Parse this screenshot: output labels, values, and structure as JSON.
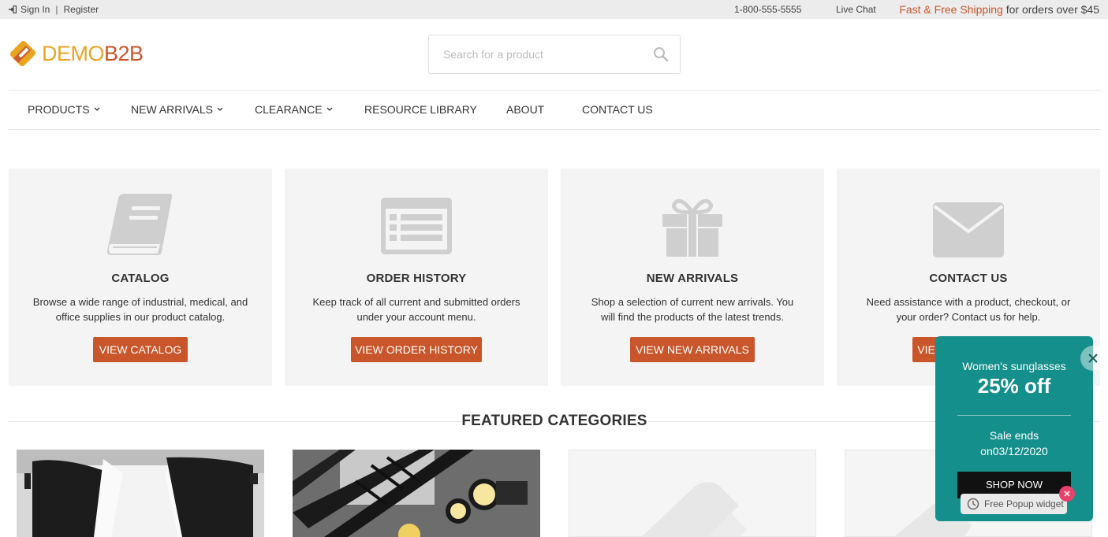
{
  "topbar": {
    "sign_in": "Sign In",
    "separator": "|",
    "register": "Register",
    "phone": "1-800-555-5555",
    "live_chat": "Live Chat",
    "shipping_highlight": "Fast & Free Shipping",
    "shipping_rest": " for orders over $45"
  },
  "brand": {
    "logo_part1": "DEMO",
    "logo_part2": "B2B",
    "color_primary": "#e8a521",
    "color_secondary": "#c8562a"
  },
  "search": {
    "placeholder": "Search for a product",
    "value": "",
    "icon": "search-icon"
  },
  "nav": {
    "items": [
      {
        "label": "PRODUCTS",
        "dropdown": true
      },
      {
        "label": "NEW ARRIVALS",
        "dropdown": true
      },
      {
        "label": "CLEARANCE",
        "dropdown": true
      },
      {
        "label": "RESOURCE LIBRARY",
        "dropdown": false
      },
      {
        "label": "ABOUT",
        "dropdown": false
      },
      {
        "label": "CONTACT US",
        "dropdown": false
      }
    ]
  },
  "cards": [
    {
      "icon": "book-icon",
      "title": "CATALOG",
      "description": "Browse a wide range of industrial, medical, and office supplies in our product catalog.",
      "button": "VIEW CATALOG"
    },
    {
      "icon": "list-icon",
      "title": "ORDER HISTORY",
      "description": "Keep track of all current and submitted orders under your account menu.",
      "button": "VIEW ORDER HISTORY"
    },
    {
      "icon": "gift-icon",
      "title": "NEW ARRIVALS",
      "description": "Shop a selection of current new arrivals. You will find the products of the latest trends.",
      "button": "VIEW NEW ARRIVALS"
    },
    {
      "icon": "envelope-icon",
      "title": "CONTACT US",
      "description": "Need assistance with a product, checkout, or your order? Contact us for help.",
      "button": "VIEW CONTACT US"
    }
  ],
  "featured": {
    "heading": "FEATURED CATEGORIES"
  },
  "popup": {
    "line1": "Women's sunglasses",
    "line2": "25% off",
    "line3": "Sale ends",
    "line4": "on03/12/2020",
    "button": "SHOP NOW",
    "badge": "Free Popup widget",
    "accent": "#158f8b"
  },
  "colors": {
    "button": "#c8562a",
    "card_bg": "#f4f4f4",
    "icon_gray": "#cfcfcf"
  }
}
